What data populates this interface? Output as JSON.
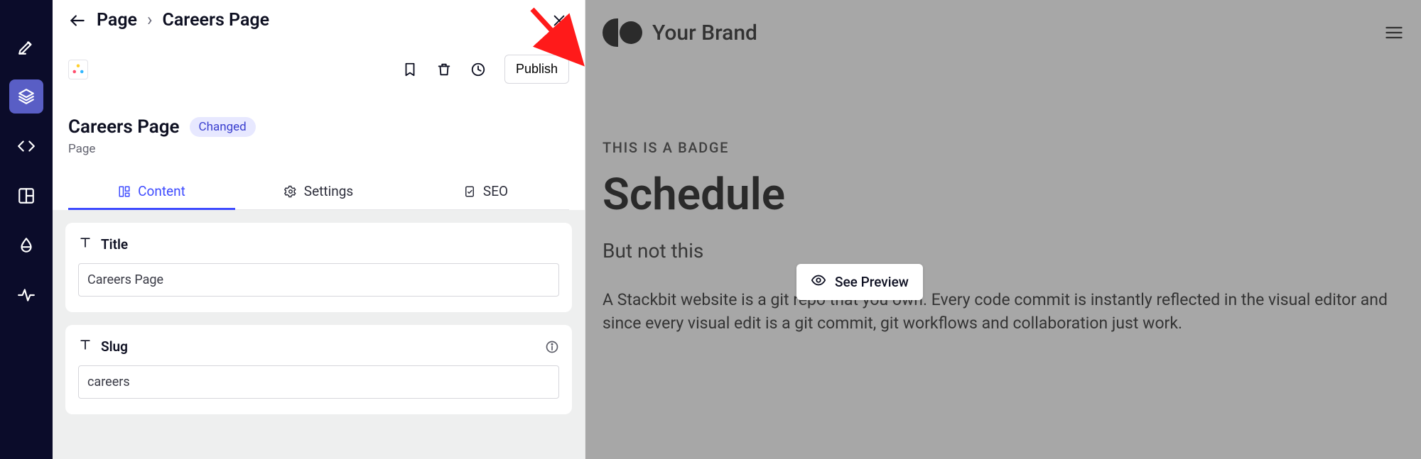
{
  "rail": {
    "items": [
      {
        "name": "edit"
      },
      {
        "name": "layers",
        "active": true
      },
      {
        "name": "code"
      },
      {
        "name": "layout"
      },
      {
        "name": "theme"
      },
      {
        "name": "activity"
      }
    ]
  },
  "breadcrumb": {
    "root": "Page",
    "current": "Careers Page"
  },
  "toolbar": {
    "publish_label": "Publish"
  },
  "page_meta": {
    "title": "Careers Page",
    "status_badge": "Changed",
    "type_label": "Page"
  },
  "tabs": [
    {
      "id": "content",
      "label": "Content",
      "active": true
    },
    {
      "id": "settings",
      "label": "Settings"
    },
    {
      "id": "seo",
      "label": "SEO"
    }
  ],
  "fields": {
    "title": {
      "label": "Title",
      "value": "Careers Page"
    },
    "slug": {
      "label": "Slug",
      "value": "careers"
    }
  },
  "preview": {
    "brand": "Your Brand",
    "badge_text": "THIS IS A BADGE",
    "heading": "Schedule",
    "subheading": "But not this",
    "paragraph": "A Stackbit website is a git repo that you own. Every code commit is instantly reflected in the visual editor and since every visual edit is a git commit, git workflows and collaboration just work.",
    "see_preview_label": "See Preview"
  }
}
